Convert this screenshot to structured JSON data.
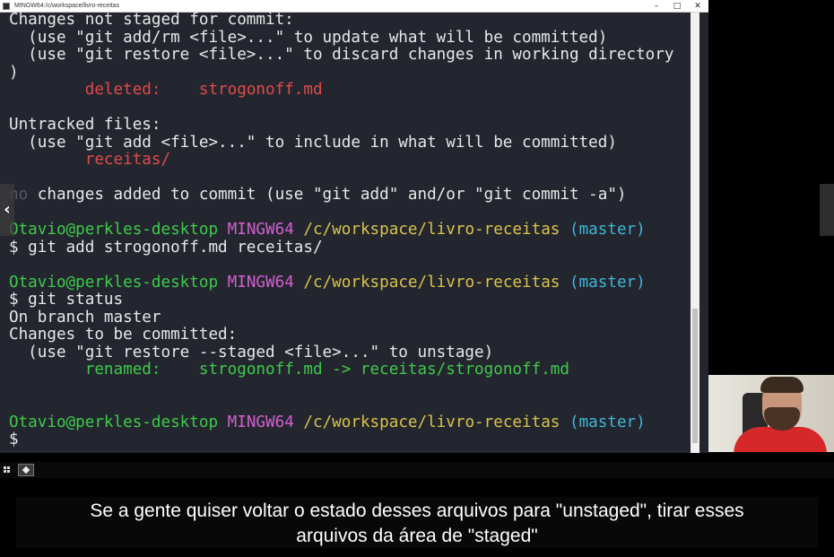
{
  "window": {
    "title": "MINGW64:/c/workspace/livro-receitas",
    "controls": {
      "minimize": "–",
      "maximize": "□",
      "close": "✕"
    }
  },
  "terminal": {
    "lines": [
      [
        {
          "text": "Changes not staged for commit:",
          "color": "default"
        }
      ],
      [
        {
          "text": "  (use \"git add/rm <file>...\" to update what will be committed)",
          "color": "default"
        }
      ],
      [
        {
          "text": "  (use \"git restore <file>...\" to discard changes in working directory",
          "color": "default"
        }
      ],
      [
        {
          "text": ")",
          "color": "default"
        }
      ],
      [
        {
          "text": "        ",
          "color": "default"
        },
        {
          "text": "deleted:    strogonoff.md",
          "color": "red"
        }
      ],
      [
        {
          "text": "",
          "color": "default"
        }
      ],
      [
        {
          "text": "Untracked files:",
          "color": "default"
        }
      ],
      [
        {
          "text": "  (use \"git add <file>...\" to include in what will be committed)",
          "color": "default"
        }
      ],
      [
        {
          "text": "        ",
          "color": "default"
        },
        {
          "text": "receitas/",
          "color": "red"
        }
      ],
      [
        {
          "text": "",
          "color": "default"
        }
      ],
      [
        {
          "text": "no",
          "color": "dim"
        },
        {
          "text": " changes added to commit (use \"git add\" and/or \"git commit -a\")",
          "color": "default"
        }
      ],
      [
        {
          "text": "",
          "color": "default"
        }
      ],
      [
        {
          "text": "Otavio@perkles-desktop",
          "color": "green"
        },
        {
          "text": " ",
          "color": "default"
        },
        {
          "text": "MINGW64",
          "color": "pink"
        },
        {
          "text": " ",
          "color": "default"
        },
        {
          "text": "/c/workspace/livro-receitas",
          "color": "yellow"
        },
        {
          "text": " ",
          "color": "default"
        },
        {
          "text": "(master)",
          "color": "cyan"
        }
      ],
      [
        {
          "text": "$ git add strogonoff.md receitas/",
          "color": "default"
        }
      ],
      [
        {
          "text": "",
          "color": "default"
        }
      ],
      [
        {
          "text": "Otavio@perkles-desktop",
          "color": "green"
        },
        {
          "text": " ",
          "color": "default"
        },
        {
          "text": "MINGW64",
          "color": "pink"
        },
        {
          "text": " ",
          "color": "default"
        },
        {
          "text": "/c/workspace/livro-receitas",
          "color": "yellow"
        },
        {
          "text": " ",
          "color": "default"
        },
        {
          "text": "(master)",
          "color": "cyan"
        }
      ],
      [
        {
          "text": "$ git status",
          "color": "default"
        }
      ],
      [
        {
          "text": "On branch master",
          "color": "default"
        }
      ],
      [
        {
          "text": "Changes to be committed:",
          "color": "default"
        }
      ],
      [
        {
          "text": "  (use \"git restore --staged <file>...\" to unstage)",
          "color": "default"
        }
      ],
      [
        {
          "text": "        ",
          "color": "default"
        },
        {
          "text": "renamed:    strogonoff.md -> receitas/strogonoff.md",
          "color": "green"
        }
      ],
      [
        {
          "text": "",
          "color": "default"
        }
      ],
      [
        {
          "text": "",
          "color": "default"
        }
      ],
      [
        {
          "text": "Otavio@perkles-desktop",
          "color": "green"
        },
        {
          "text": " ",
          "color": "default"
        },
        {
          "text": "MINGW64",
          "color": "pink"
        },
        {
          "text": " ",
          "color": "default"
        },
        {
          "text": "/c/workspace/livro-receitas",
          "color": "yellow"
        },
        {
          "text": " ",
          "color": "default"
        },
        {
          "text": "(master)",
          "color": "cyan"
        }
      ],
      [
        {
          "text": "$",
          "color": "default"
        }
      ]
    ],
    "colors": {
      "background": "#24262f",
      "default": "#e8e8e8",
      "red": "#e04a4a",
      "green": "#3dcb4a",
      "pink": "#d35fd1",
      "yellow": "#d9c34a",
      "cyan": "#3fb6d6",
      "dim": "#555966"
    }
  },
  "player": {
    "prev_icon": "‹",
    "next_icon": ""
  },
  "subtitle": {
    "line1": "Se a gente quiser voltar o estado desses arquivos para \"unstaged\",  tirar esses",
    "line2": "arquivos da área de \"staged\""
  }
}
